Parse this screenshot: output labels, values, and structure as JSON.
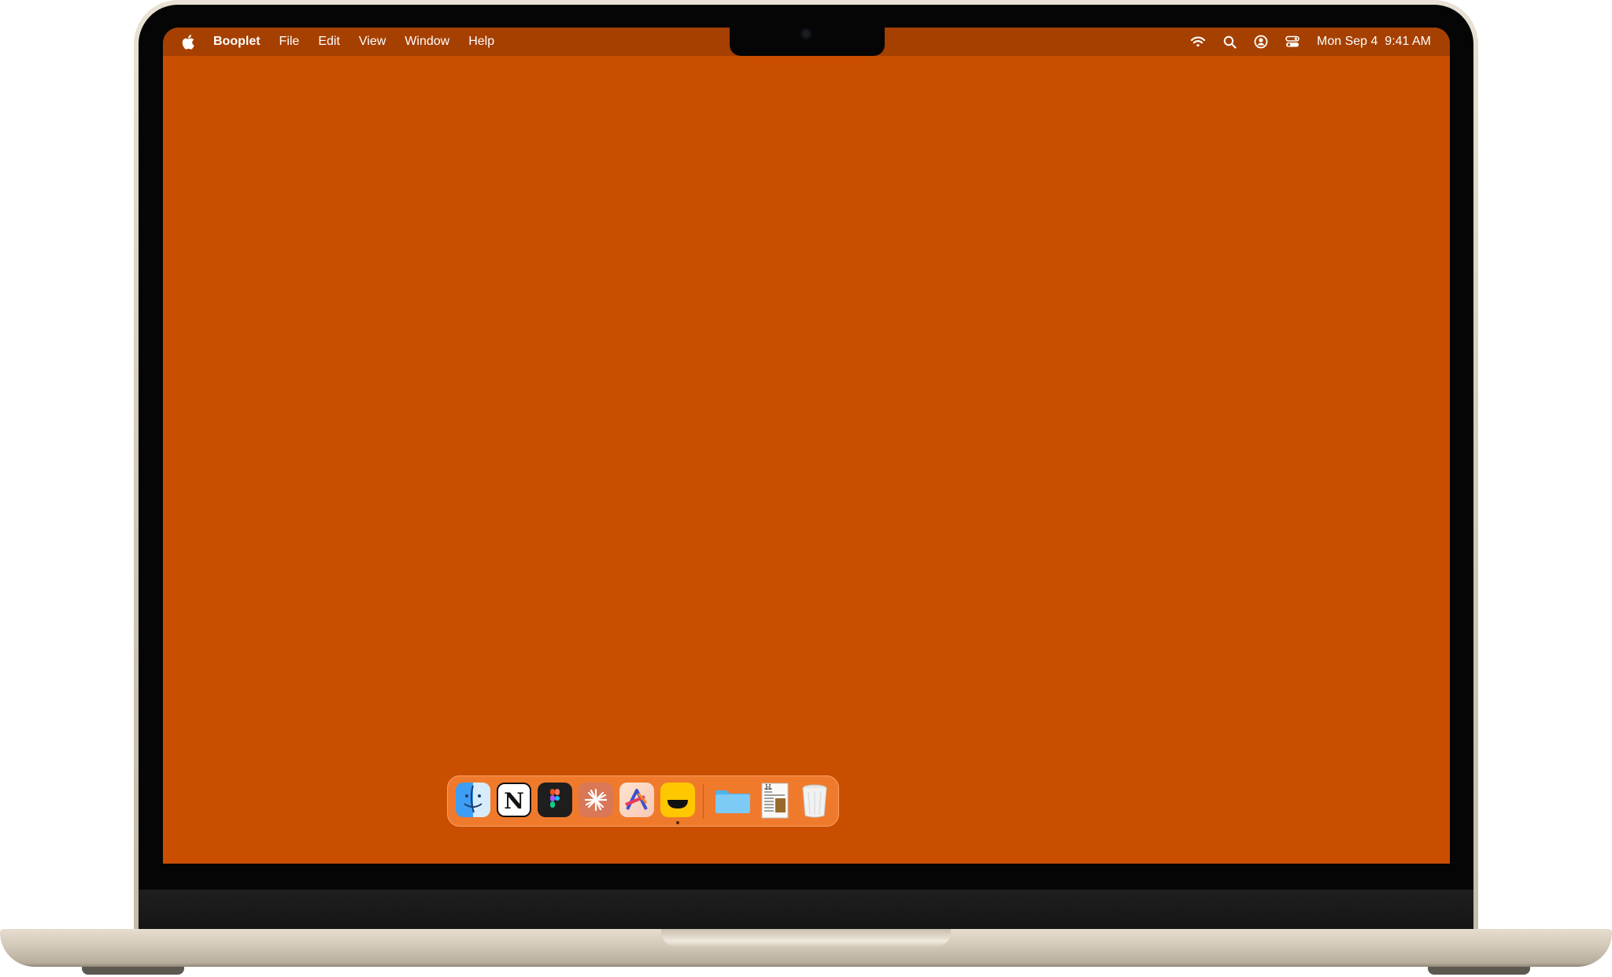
{
  "menubar": {
    "apple_icon": "apple-logo-icon",
    "app_name": "Booplet",
    "menus": [
      "File",
      "Edit",
      "View",
      "Window",
      "Help"
    ],
    "status_icons": [
      "wifi-icon",
      "search-icon",
      "user-icon",
      "control-center-icon"
    ],
    "datetime": "Mon Sep 4  9:41 AM"
  },
  "dock": {
    "apps": [
      {
        "name": "Finder",
        "icon": "finder-icon"
      },
      {
        "name": "Notion",
        "icon": "notion-icon"
      },
      {
        "name": "Figma",
        "icon": "figma-icon"
      },
      {
        "name": "Claude",
        "icon": "claude-icon"
      },
      {
        "name": "Affinity",
        "icon": "affinity-icon"
      },
      {
        "name": "Booplet",
        "icon": "booplet-icon",
        "running": true
      }
    ],
    "others": [
      {
        "name": "Folder",
        "icon": "folder-icon"
      },
      {
        "name": "Document",
        "icon": "document-icon"
      },
      {
        "name": "Trash",
        "icon": "trash-icon"
      }
    ]
  },
  "colors": {
    "desktop": "#c94e00",
    "menubar": "#a64000",
    "dock": "#f07a2c",
    "laptop_shell": "#ddd4c5"
  }
}
